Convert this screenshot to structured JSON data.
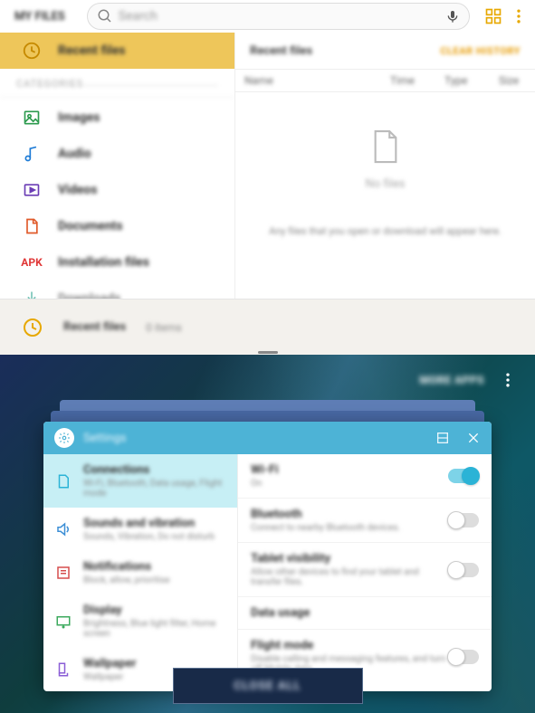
{
  "topbar": {
    "app_title": "MY FILES",
    "search_placeholder": "Search"
  },
  "sidebar": {
    "categories_label": "CATEGORIES",
    "recent": "Recent files",
    "items": [
      {
        "label": "Images"
      },
      {
        "label": "Audio"
      },
      {
        "label": "Videos"
      },
      {
        "label": "Documents"
      },
      {
        "label": "Installation files"
      },
      {
        "label": "Downloads"
      }
    ]
  },
  "content": {
    "title": "Recent files",
    "clear": "CLEAR HISTORY",
    "cols": {
      "name": "Name",
      "time": "Time",
      "type": "Type",
      "size": "Size"
    },
    "empty_title": "No files",
    "empty_sub": "Any files that you open or download will appear here."
  },
  "secondary": {
    "label": "Recent files",
    "count": "0 items"
  },
  "overview": {
    "more_apps": "MORE APPS",
    "close_all": "CLOSE ALL"
  },
  "settings_card": {
    "title": "Settings",
    "left": [
      {
        "title": "Connections",
        "sub": "Wi-Fi, Bluetooth, Data usage, Flight mode"
      },
      {
        "title": "Sounds and vibration",
        "sub": "Sounds, Vibration, Do not disturb"
      },
      {
        "title": "Notifications",
        "sub": "Block, allow, prioritise"
      },
      {
        "title": "Display",
        "sub": "Brightness, Blue light filter, Home screen"
      },
      {
        "title": "Wallpaper",
        "sub": "Wallpaper"
      }
    ],
    "right": [
      {
        "title": "Wi-Fi",
        "sub": "On",
        "toggle": true,
        "on": true
      },
      {
        "title": "Bluetooth",
        "sub": "Connect to nearby Bluetooth devices.",
        "toggle": true,
        "on": false
      },
      {
        "title": "Tablet visibility",
        "sub": "Allow other devices to find your tablet and transfer files.",
        "toggle": true,
        "on": false
      },
      {
        "title": "Data usage",
        "sub": "",
        "toggle": false
      },
      {
        "title": "Flight mode",
        "sub": "Disable calling and messaging features, and turn off Mobile data.",
        "toggle": true,
        "on": false
      }
    ]
  }
}
